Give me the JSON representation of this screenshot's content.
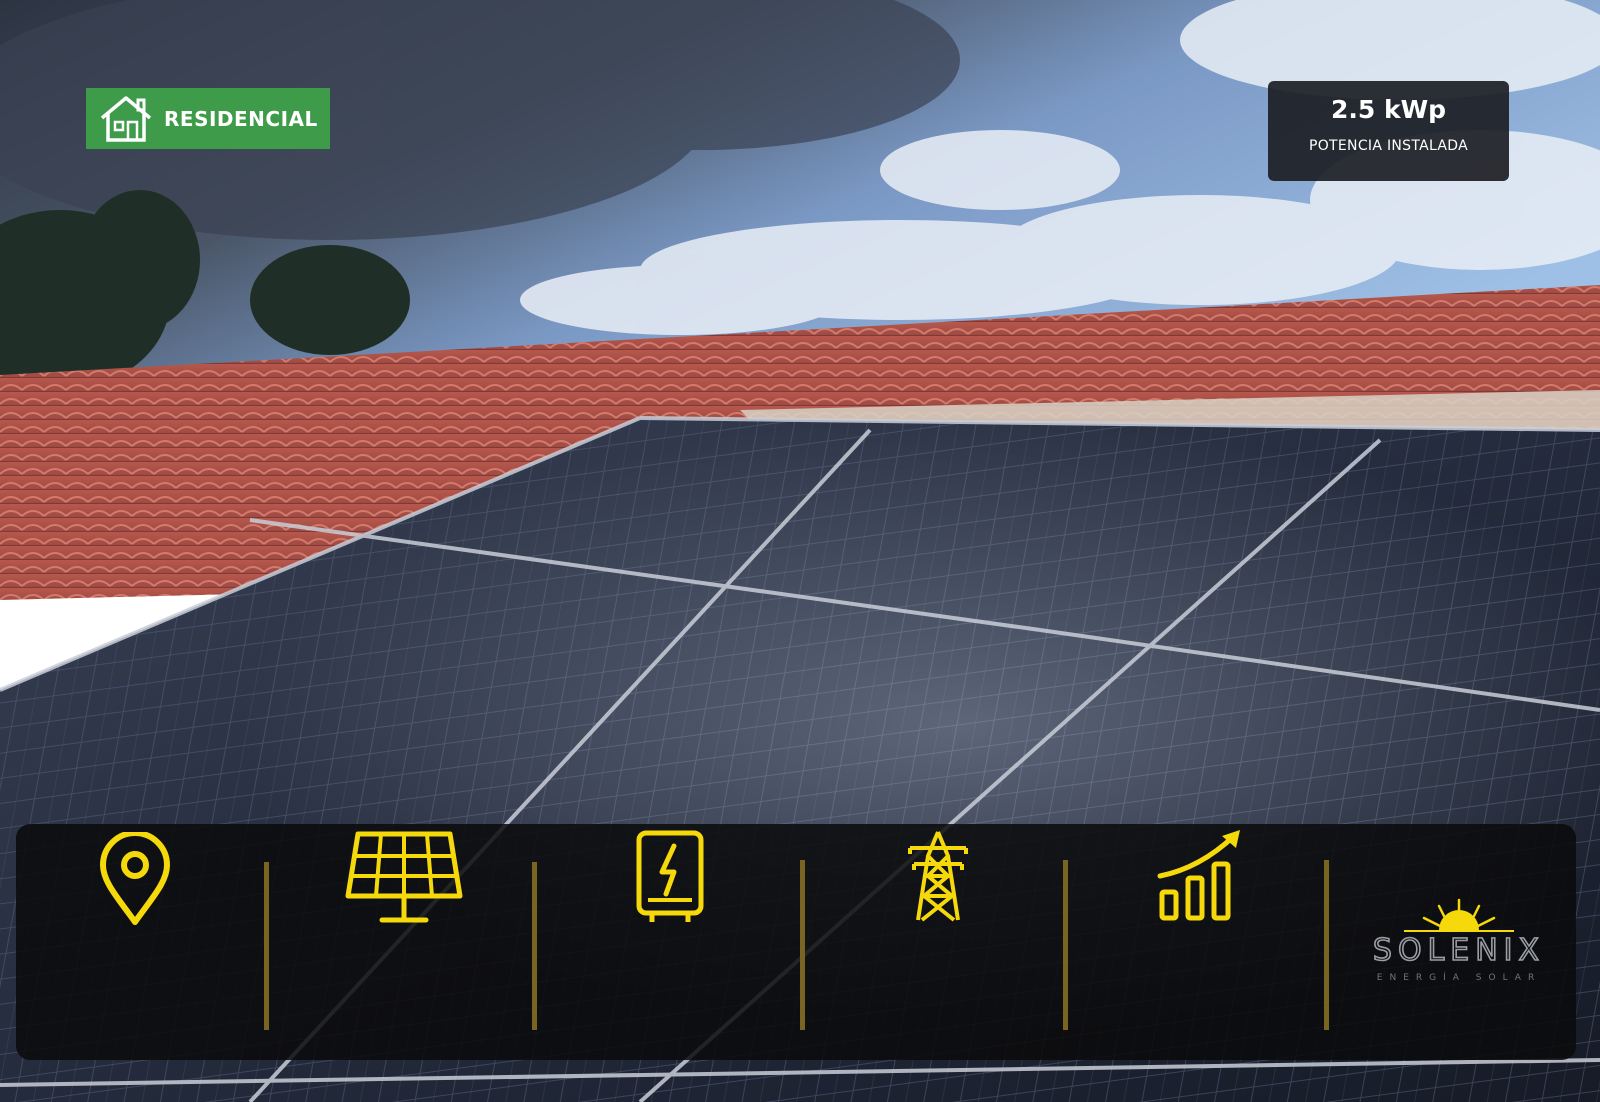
{
  "badge": {
    "label": "RESIDENCIAL",
    "icon": "house-icon",
    "color": "#3e9b49"
  },
  "power": {
    "value": "2.5 kWp",
    "caption": "POTENCIA INSTALADA"
  },
  "features": [
    {
      "icon": "location-pin-icon"
    },
    {
      "icon": "solar-panel-icon"
    },
    {
      "icon": "inverter-icon"
    },
    {
      "icon": "transmission-tower-icon"
    },
    {
      "icon": "growth-chart-icon"
    }
  ],
  "brand": {
    "name": "SOLENIX",
    "tagline": "ENERGÍA SOLAR",
    "accent": "#f5d90a"
  },
  "colors": {
    "icon_yellow": "#f5d90a",
    "roof_red": "#b4534a",
    "panel_dark": "#1e2433"
  }
}
